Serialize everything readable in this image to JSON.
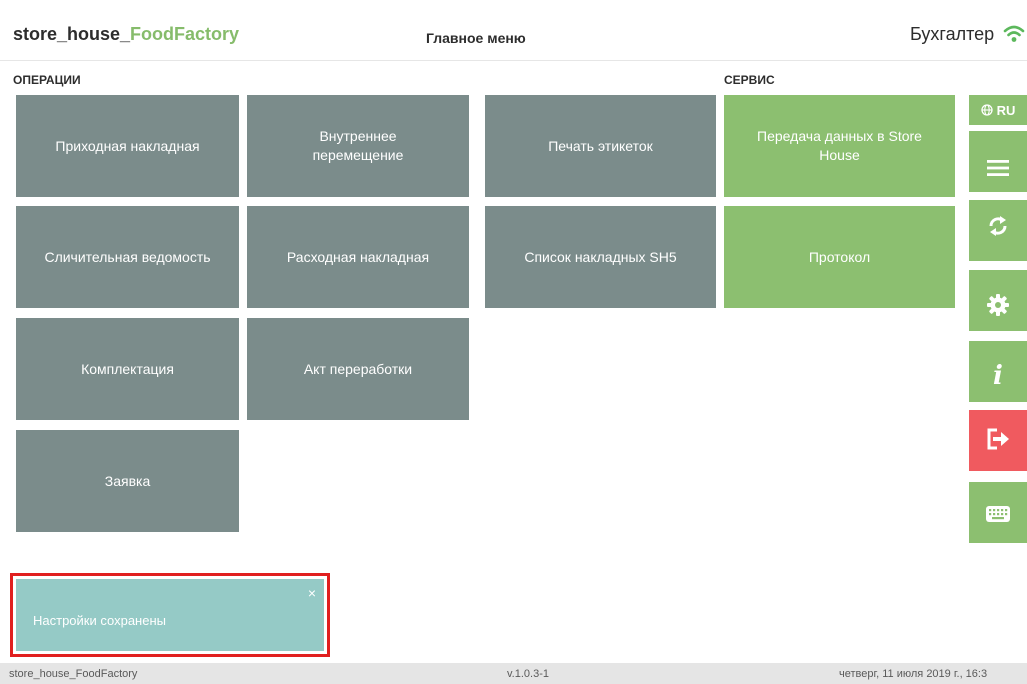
{
  "header": {
    "app_name_part1": "store_house_",
    "app_name_part2": "FoodFactory",
    "title": "Главное меню",
    "user_role": "Бухгалтер"
  },
  "sections": {
    "operations_label": "ОПЕРАЦИИ",
    "service_label": "СЕРВИС"
  },
  "tiles": {
    "incoming_invoice": "Приходная накладная",
    "internal_transfer": "Внутреннее перемещение",
    "print_labels": "Печать этикеток",
    "transfer_data": "Передача данных в Store House",
    "comparison_sheet": "Сличительная ведомость",
    "outgoing_invoice": "Расходная накладная",
    "sh5_invoice_list": "Список накладных SH5",
    "protocol": "Протокол",
    "assembly": "Комплектация",
    "processing_act": "Акт переработки",
    "request": "Заявка"
  },
  "sidebar": {
    "language_label": "RU",
    "icons": [
      "globe-icon",
      "menu-icon",
      "sync-icon",
      "gear-icon",
      "info-icon",
      "logout-icon",
      "keyboard-icon"
    ]
  },
  "toast": {
    "message": "Настройки сохранены",
    "close": "×"
  },
  "footer": {
    "app_name": "store_house_FoodFactory",
    "version": "v.1.0.3-1",
    "datetime": "четверг, 11 июля 2019 г., 16:3"
  },
  "colors": {
    "tile_gray": "#7b8c8b",
    "tile_green": "#8cbf70",
    "logout_red": "#f05a5f",
    "toast_bg": "#95cac6",
    "highlight_border": "#e01f1f"
  }
}
